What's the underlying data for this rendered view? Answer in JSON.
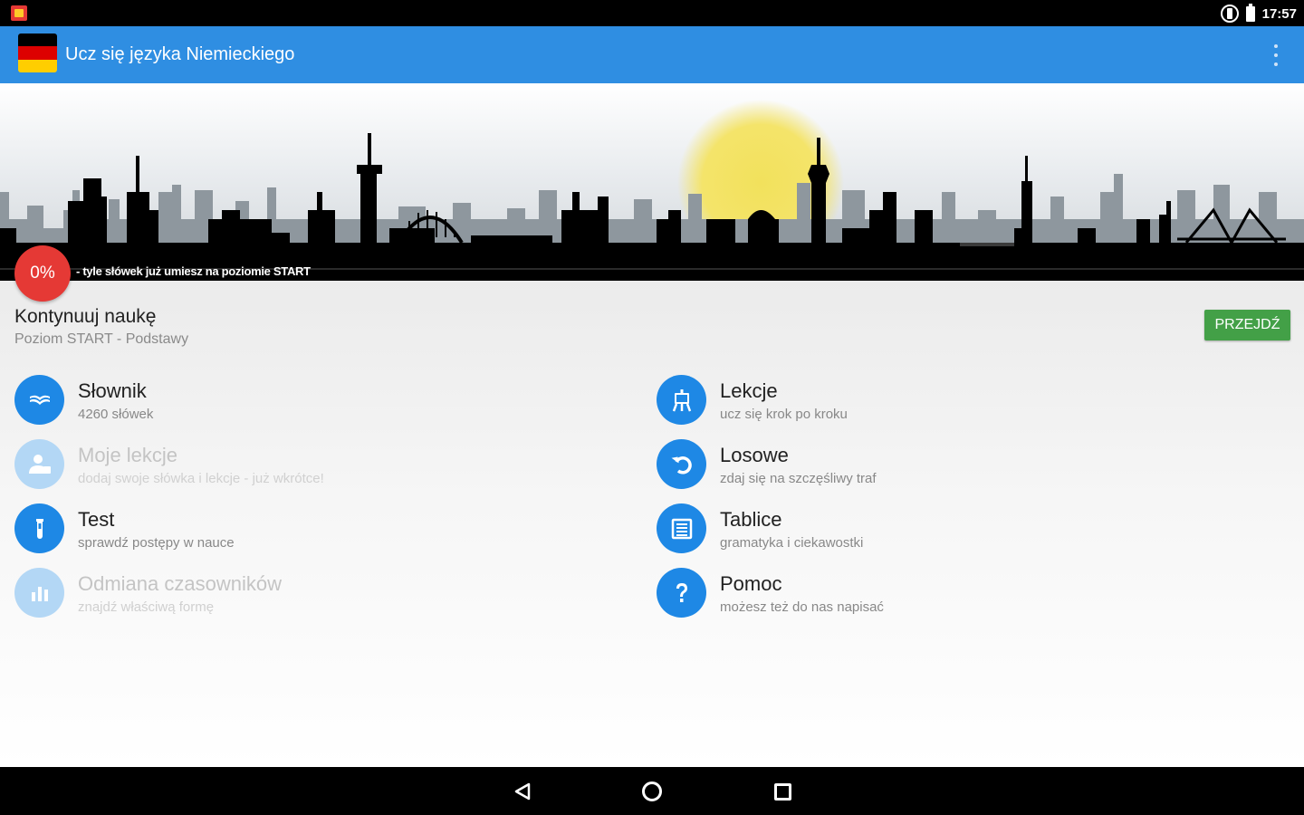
{
  "status_bar": {
    "time": "17:57",
    "icons": [
      "app-notification-icon",
      "screen-rotation-icon",
      "battery-icon"
    ]
  },
  "app_bar": {
    "title": "Ucz się języka Niemieckiego",
    "flag_colors": [
      "#000000",
      "#dd0000",
      "#ffce00"
    ]
  },
  "banner": {
    "progress": "0%",
    "progress_note": "- tyle słówek już umiesz na poziomie START",
    "sun_color": "#f2e15c"
  },
  "continue": {
    "title": "Kontynuuj naukę",
    "subtitle": "Poziom START - Podstawy",
    "button": "PRZEJDŹ"
  },
  "menu": {
    "left": [
      {
        "title": "Słownik",
        "subtitle": "4260 słówek",
        "icon": "dictionary-icon",
        "enabled": true
      },
      {
        "title": "Moje lekcje",
        "subtitle": "dodaj swoje słówka i lekcje - już wkrótce!",
        "icon": "user-lessons-icon",
        "enabled": false
      },
      {
        "title": "Test",
        "subtitle": "sprawdź postępy w nauce",
        "icon": "test-tube-icon",
        "enabled": true
      },
      {
        "title": "Odmiana czasowników",
        "subtitle": "znajdź właściwą formę",
        "icon": "bar-chart-icon",
        "enabled": false
      }
    ],
    "right": [
      {
        "title": "Lekcje",
        "subtitle": "ucz się krok po kroku",
        "icon": "easel-icon",
        "enabled": true
      },
      {
        "title": "Losowe",
        "subtitle": "zdaj się na szczęśliwy traf",
        "icon": "undo-icon",
        "enabled": true
      },
      {
        "title": "Tablice",
        "subtitle": "gramatyka i ciekawostki",
        "icon": "table-icon",
        "enabled": true
      },
      {
        "title": "Pomoc",
        "subtitle": "możesz też do nas napisać",
        "icon": "help-icon",
        "enabled": true
      }
    ]
  },
  "colors": {
    "app_bar": "#2f8ee2",
    "accent_blue": "#1e88e5",
    "progress_red": "#e53935",
    "go_green": "#43a047"
  },
  "nav_bar": {
    "icons": [
      "back-icon",
      "home-icon",
      "recents-icon"
    ]
  }
}
